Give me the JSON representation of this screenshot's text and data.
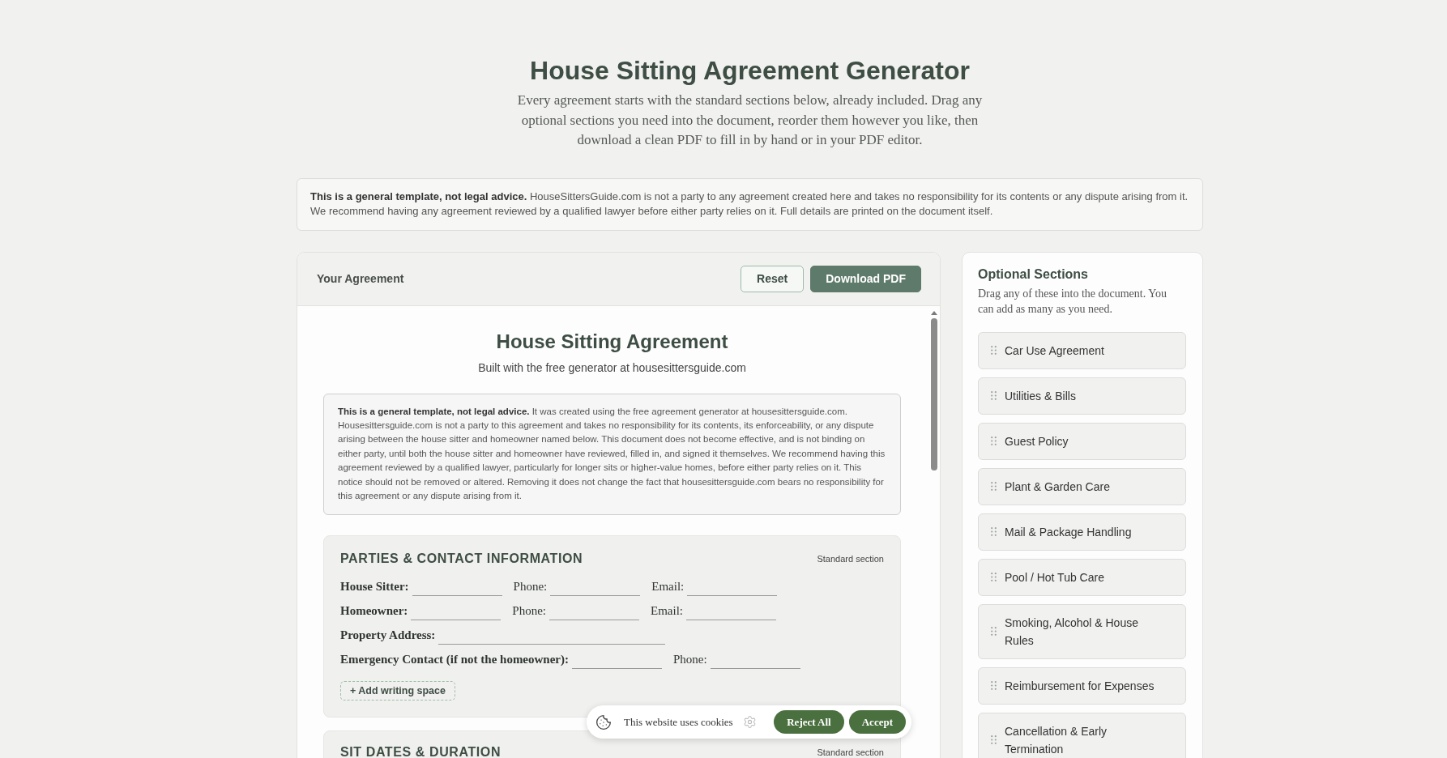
{
  "header": {
    "title": "House Sitting Agreement Generator",
    "intro": "Every agreement starts with the standard sections below, already included. Drag any optional sections you need into the document, reorder them however you like, then download a clean PDF to fill in by hand or in your PDF editor."
  },
  "disclaimer": "**This is a general template, not legal advice.** HouseSittersGuide.com is not a party to any agreement created here and takes no responsibility for its contents or any dispute arising from it. We recommend having any agreement reviewed by a qualified lawyer before either party relies on it. Full details are printed on the document itself.",
  "agreement_panel": {
    "title": "Your Agreement",
    "buttons": [
      {
        "label": "Reset",
        "kind": "secondary"
      },
      {
        "label": "Download PDF",
        "kind": "primary"
      }
    ],
    "document": {
      "title": "House Sitting Agreement",
      "subtitle": "Built with the free generator at housesittersguide.com",
      "notice": "**This is a general template, not legal advice.** It was created using the free agreement generator at housesittersguide.com. Housesittersguide.com is not a party to this agreement and takes no responsibility for its contents, its enforceability, or any dispute arising between the house sitter and homeowner named below. This document does not become effective, and is not binding on either party, until both the house sitter and homeowner have reviewed, filled in, and signed it themselves. We recommend having this agreement reviewed by a qualified lawyer, particularly for longer sits or higher-value homes, before either party relies on it. This notice should not be removed or altered. Removing it does not change the fact that housesittersguide.com bears no responsibility for this agreement or any dispute arising from it.",
      "sections": [
        {
          "title": "PARTIES & CONTACT INFORMATION",
          "tag": "Standard section",
          "rows": [
            {
              "fields": [
                {
                  "label": "House Sitter:",
                  "kind": "main"
                },
                {
                  "label": "Phone:",
                  "kind": "sub"
                },
                {
                  "label": "Email:",
                  "kind": "sub"
                }
              ]
            },
            {
              "fields": [
                {
                  "label": "Homeowner:",
                  "kind": "main"
                },
                {
                  "label": "Phone:",
                  "kind": "sub"
                },
                {
                  "label": "Email:",
                  "kind": "sub"
                }
              ]
            },
            {
              "fields": [
                {
                  "label": "Property Address:",
                  "kind": "long"
                }
              ]
            },
            {
              "fields": [
                {
                  "label": "Emergency Contact (if not the homeowner):",
                  "kind": "main"
                },
                {
                  "label": "Phone:",
                  "kind": "sub"
                }
              ]
            }
          ],
          "add_button": "+ Add writing space"
        },
        {
          "title": "SIT DATES & DURATION",
          "tag": "Standard section"
        }
      ]
    }
  },
  "optional_sections": {
    "title": "Optional Sections",
    "description": "Drag any of these into the document. You can add as many as you need.",
    "items": [
      "Car Use Agreement",
      "Utilities & Bills",
      "Guest Policy",
      "Plant & Garden Care",
      "Mail & Package Handling",
      "Pool / Hot Tub Care",
      "Smoking, Alcohol & House Rules",
      "Reimbursement for Expenses",
      "Cancellation & Early Termination"
    ]
  },
  "cookie_banner": {
    "text": "This website uses cookies",
    "buttons": [
      "Reject All",
      "Accept"
    ]
  }
}
